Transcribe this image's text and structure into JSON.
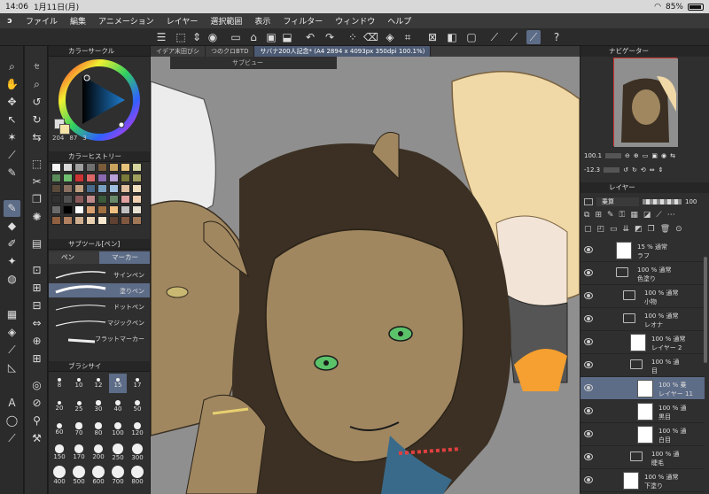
{
  "status": {
    "time": "14:06",
    "date": "1月11日(月)",
    "battery": "85%"
  },
  "menu": [
    "ファイル",
    "編集",
    "アニメーション",
    "レイヤー",
    "選択範囲",
    "表示",
    "フィルター",
    "ウィンドウ",
    "ヘルプ"
  ],
  "panels": {
    "color_circle": "カラーサークル",
    "color_history": "カラーヒストリー",
    "subtool": "サブツール[ペン]",
    "brush_size": "ブラシサイ",
    "navigator": "ナビゲーター",
    "layer": "レイヤー",
    "subview": "サブビュー"
  },
  "color_readout": {
    "h": "204",
    "s": "87",
    "v": "3"
  },
  "subtool_tabs": {
    "pen": "ペン",
    "marker": "マーカー"
  },
  "brushes": [
    "サインペン",
    "塗りペン",
    "ドットペン",
    "マジックペン",
    "フラットマーカー"
  ],
  "brush_sizes": [
    "8",
    "10",
    "12",
    "15",
    "17",
    "20",
    "25",
    "30",
    "40",
    "50",
    "60",
    "70",
    "80",
    "100",
    "120",
    "150",
    "170",
    "200",
    "250",
    "300",
    "400",
    "500",
    "600",
    "700",
    "800"
  ],
  "tabs": [
    "イデア末田びシ",
    "つのクロBTD",
    "サバナ200人記念* (A4 2894 x 4093px 350dpi 100.1%)"
  ],
  "navigator": {
    "zoom": "100.1",
    "rotation": "-12.3"
  },
  "layer_controls": {
    "blend_mode": "乗算",
    "opacity": "100"
  },
  "layers": [
    {
      "opacity": "15 %",
      "mode": "通常",
      "name": "ラフ",
      "type": "raster"
    },
    {
      "opacity": "100 %",
      "mode": "通常",
      "name": "色塗り",
      "type": "folder"
    },
    {
      "opacity": "100 %",
      "mode": "通常",
      "name": "小物",
      "type": "folder"
    },
    {
      "opacity": "100 %",
      "mode": "通常",
      "name": "レオナ",
      "type": "folder"
    },
    {
      "opacity": "100 %",
      "mode": "通常",
      "name": "レイヤー 2",
      "type": "raster"
    },
    {
      "opacity": "100 %",
      "mode": "通",
      "name": "目",
      "type": "folder"
    },
    {
      "opacity": "100 %",
      "mode": "乗",
      "name": "レイヤー 11",
      "type": "raster"
    },
    {
      "opacity": "100 %",
      "mode": "通",
      "name": "黒目",
      "type": "raster"
    },
    {
      "opacity": "100 %",
      "mode": "通",
      "name": "白目",
      "type": "raster"
    },
    {
      "opacity": "100 %",
      "mode": "通",
      "name": "睫毛",
      "type": "folder"
    },
    {
      "opacity": "100 %",
      "mode": "通常",
      "name": "下塗り",
      "type": "raster"
    }
  ],
  "colors": {
    "accent": "#5d6c87",
    "panel": "#2f2f2f",
    "canvas_bg": "#8f8f8f",
    "skin": "#a08760",
    "hair": "#3b3023",
    "eye": "#5bc26a",
    "blonde": "#f0d9a7"
  },
  "swatches": [
    "#f4f4f4",
    "#d8d8d8",
    "#a0a0a0",
    "#707070",
    "#7a5c3a",
    "#c9a25e",
    "#e6c27a",
    "#d4d4a0",
    "#5a8a5a",
    "#6fbf6f",
    "#c33",
    "#d66",
    "#8a6ab0",
    "#b8a0d8",
    "#7a7a3a",
    "#a0a060",
    "#5a4a3a",
    "#8a7060",
    "#c0a080",
    "#4a6a8a",
    "#7aa0c0",
    "#a0c0e0",
    "#e0c0a0",
    "#f0e0c0",
    "#303030",
    "#505050",
    "#8a5a5a",
    "#c08a8a",
    "#3a5a3a",
    "#6a8a6a",
    "#e0a0a0",
    "#f0d0b0",
    "#6a6a6a",
    "#000000",
    "#ffffff",
    "#d8a070",
    "#a07040",
    "#f0c080",
    "#c0c0c0",
    "#e8e0d0",
    "#906040",
    "#b08060",
    "#d0b090",
    "#e8d0b0",
    "#f8e8d0",
    "#604030",
    "#805840",
    "#a07858"
  ]
}
